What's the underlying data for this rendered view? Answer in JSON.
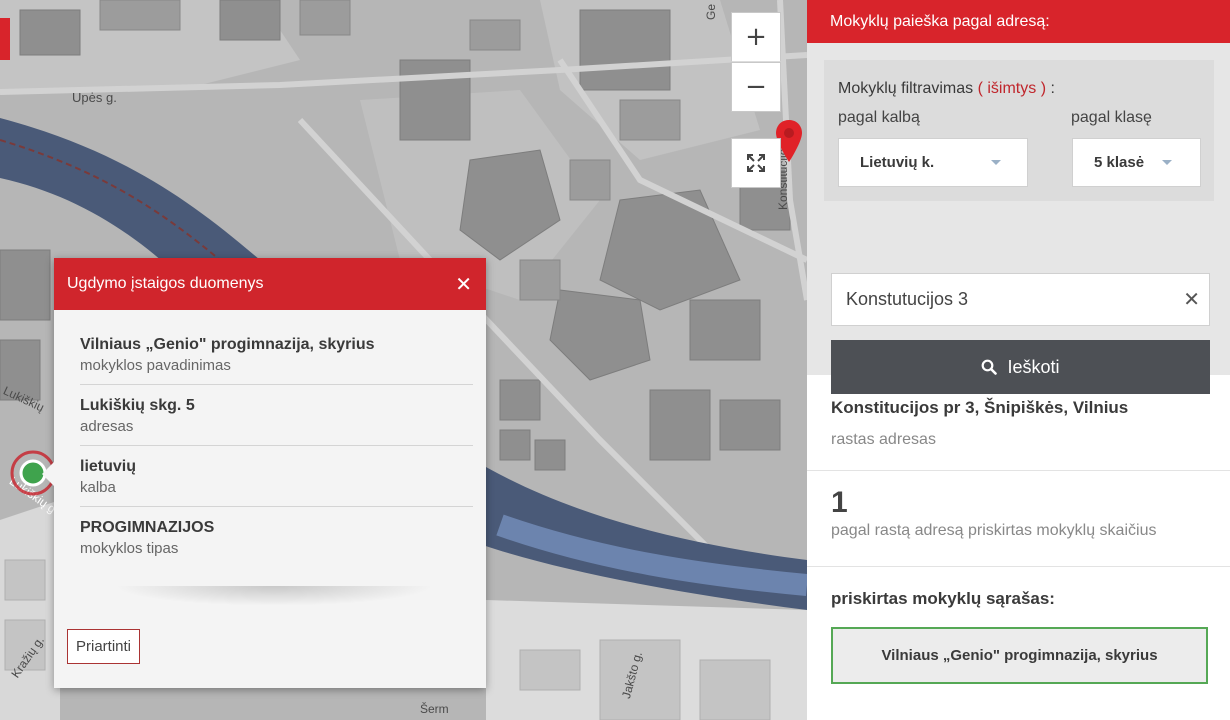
{
  "map": {
    "streets": {
      "upes": "Upės g.",
      "konstitucijos": "Konstitucijos",
      "gedimino": "Ge",
      "lukiskiu": "Lukiškių",
      "lukiskiu_g": "Lukiškių g",
      "kraziu": "Kražių g.",
      "jaksto": "Jakšto g.",
      "sermuksniu": "Šerm"
    },
    "controls": {
      "zoom_in": "+",
      "zoom_out": "−"
    }
  },
  "popup": {
    "title": "Ugdymo įstaigos duomenys",
    "close": "✕",
    "rows": [
      {
        "value": "Vilniaus „Genio\" progimnazija, skyrius",
        "label": "mokyklos pavadinimas"
      },
      {
        "value": "Lukiškių skg. 5",
        "label": "adresas"
      },
      {
        "value": "lietuvių",
        "label": "kalba"
      },
      {
        "value": "PROGIMNAZIJOS",
        "label": "mokyklos tipas"
      }
    ],
    "zoom_button": "Priartinti"
  },
  "sidebar": {
    "header": "Mokyklų paieška pagal adresą:",
    "filter": {
      "title": "Mokyklų filtravimas",
      "exceptions": "( išimtys )",
      "colon": " :",
      "language_label": "pagal kalbą",
      "grade_label": "pagal klasę",
      "language_value": "Lietuvių k.",
      "grade_value": "5 klasė"
    },
    "search": {
      "value": "Konstutucijos 3",
      "clear": "✕",
      "button": "Ieškoti"
    },
    "result": {
      "address": "Konstitucijos pr 3, Šnipiškės, Vilnius",
      "address_label": "rastas adresas",
      "count": "1",
      "count_label": "pagal rastą adresą priskirtas mokyklų skaičius",
      "list_title": "priskirtas mokyklų sąrašas:",
      "schools": [
        "Vilniaus „Genio\" progimnazija, skyrius"
      ]
    }
  },
  "colors": {
    "accent_red": "#d8242b",
    "button_dark": "#4d5055",
    "selected_green": "#55a855",
    "river": "#4a5a78"
  }
}
